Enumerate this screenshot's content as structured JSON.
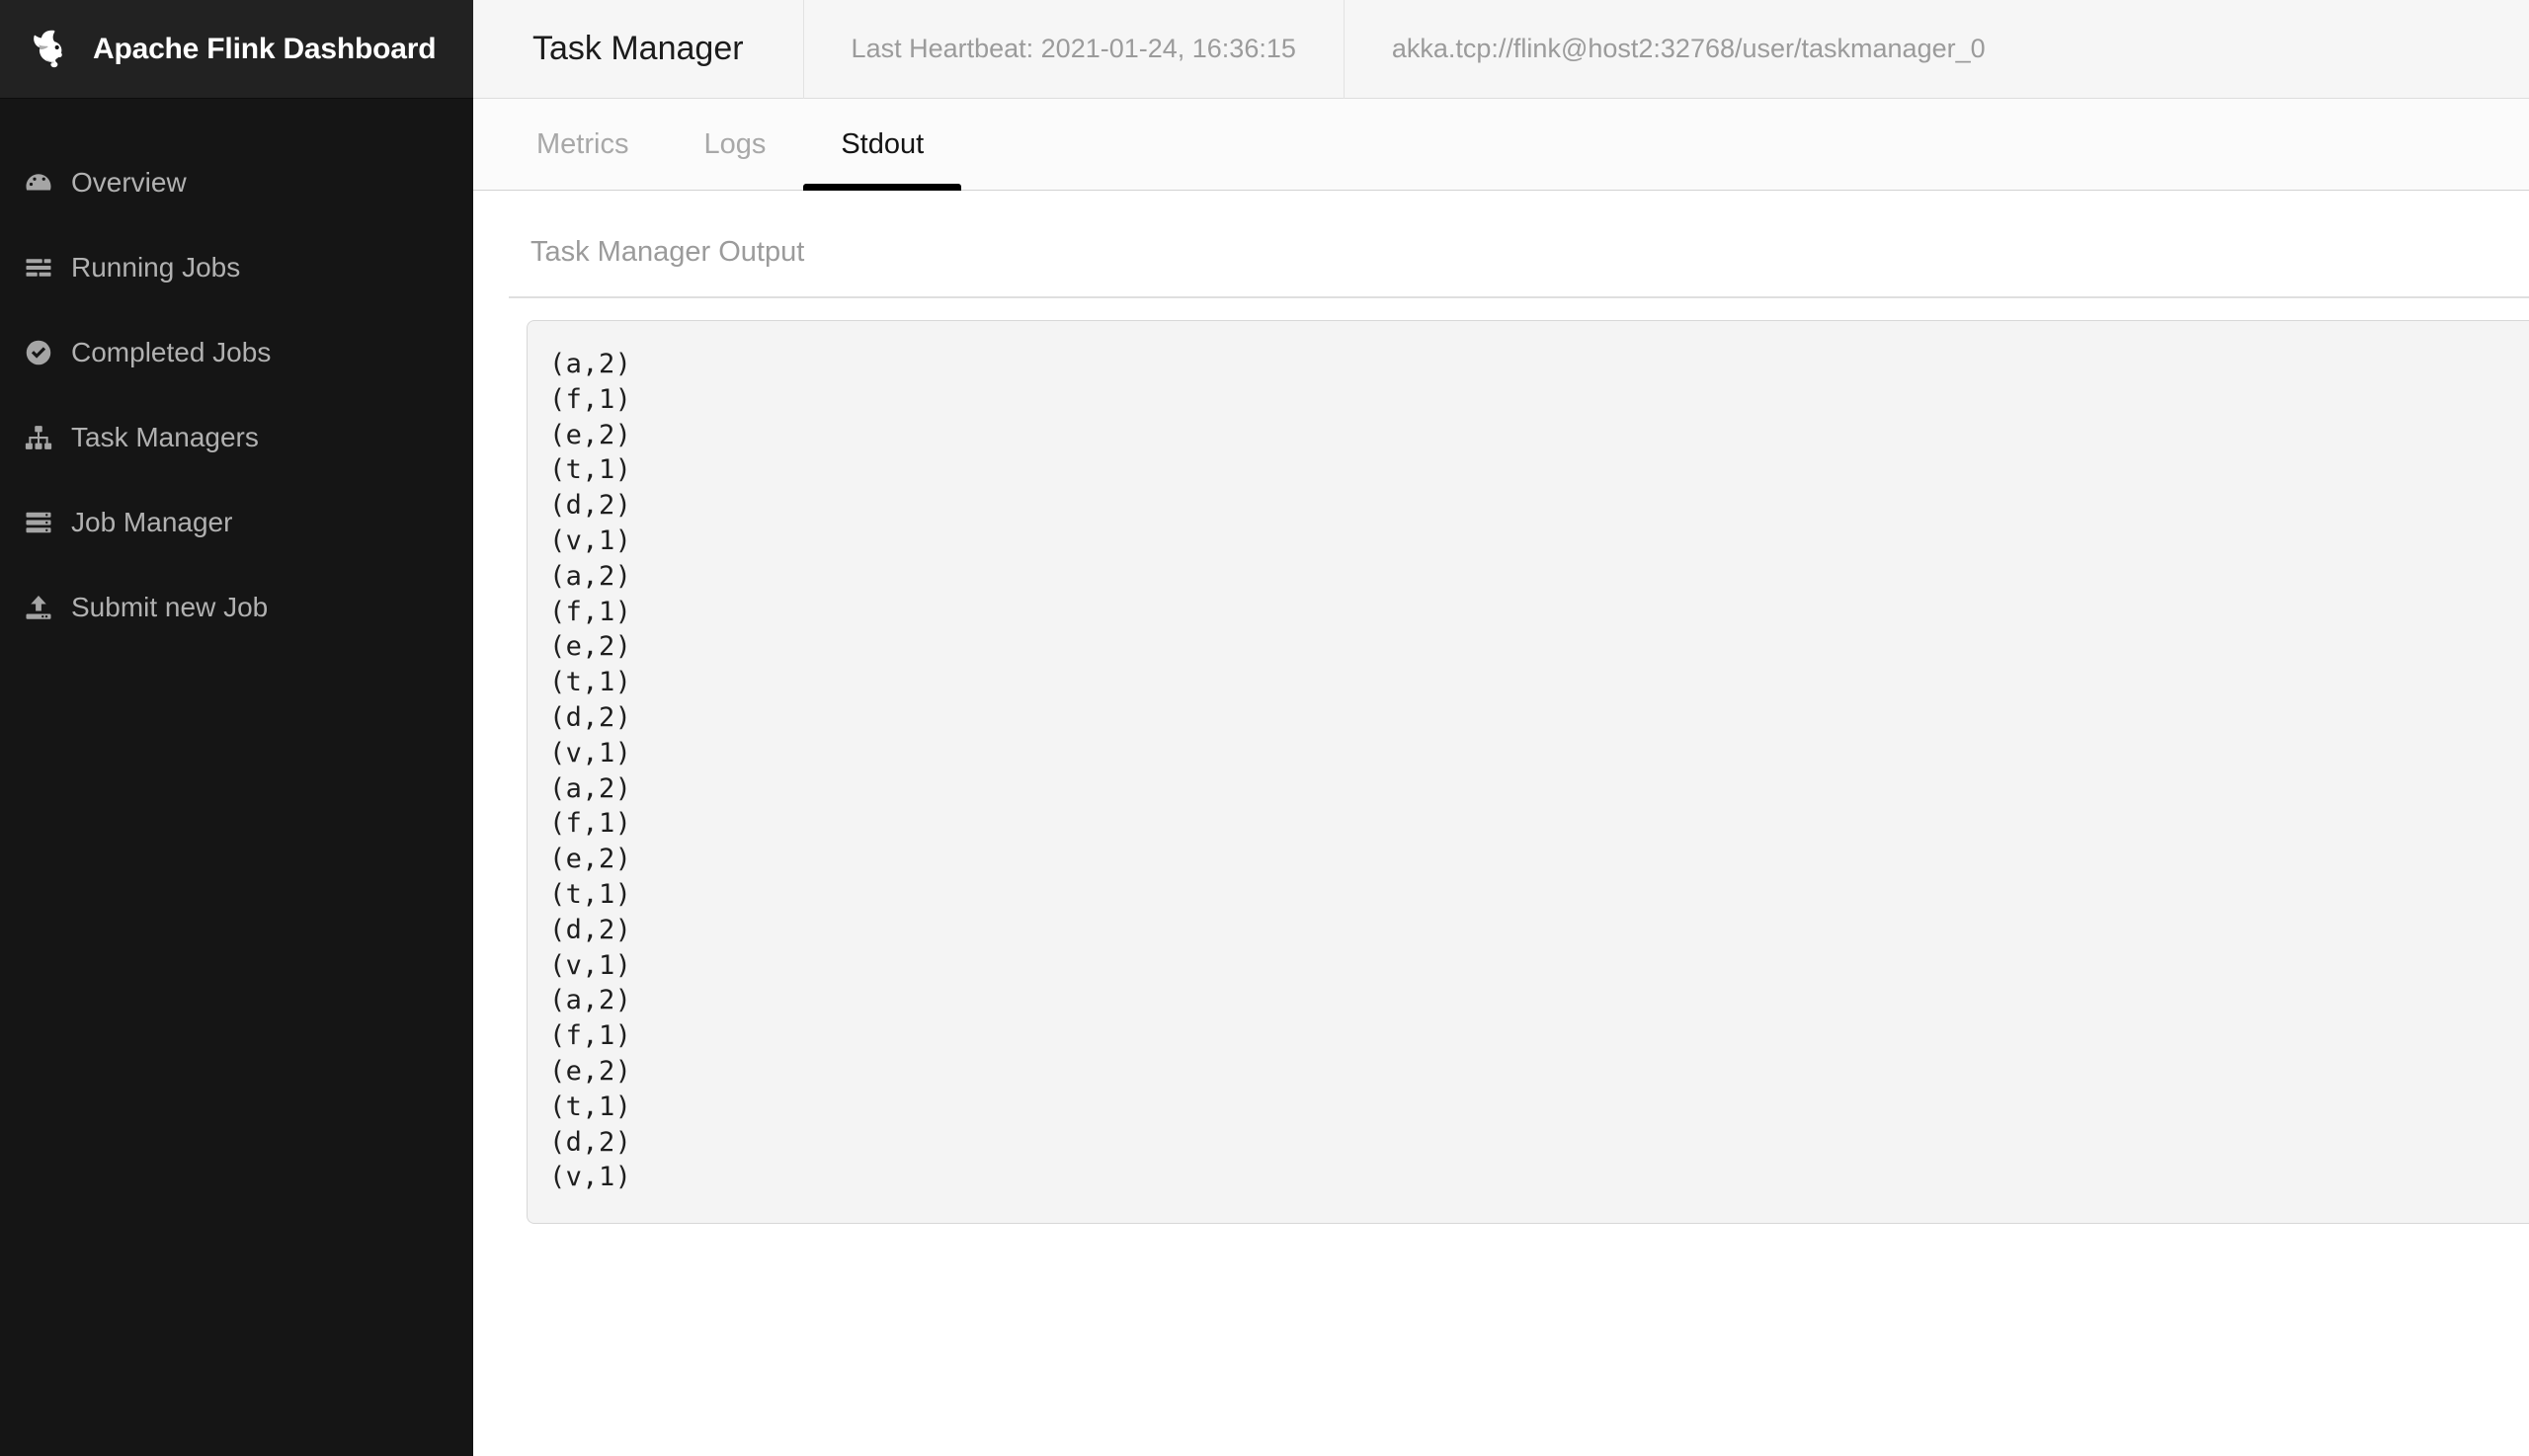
{
  "brand": {
    "title": "Apache Flink Dashboard",
    "logo_icon": "flink-squirrel-icon"
  },
  "sidebar": {
    "items": [
      {
        "label": "Overview",
        "icon": "dashboard-gauge-icon"
      },
      {
        "label": "Running Jobs",
        "icon": "list-bars-icon"
      },
      {
        "label": "Completed Jobs",
        "icon": "check-circle-icon"
      },
      {
        "label": "Task Managers",
        "icon": "sitemap-icon"
      },
      {
        "label": "Job Manager",
        "icon": "server-stack-icon"
      },
      {
        "label": "Submit new Job",
        "icon": "upload-icon"
      }
    ]
  },
  "topbar": {
    "title": "Task Manager",
    "heartbeat": "Last Heartbeat: 2021-01-24, 16:36:15",
    "address": "akka.tcp://flink@host2:32768/user/taskmanager_0"
  },
  "tabs": [
    {
      "label": "Metrics",
      "active": false
    },
    {
      "label": "Logs",
      "active": false
    },
    {
      "label": "Stdout",
      "active": true
    }
  ],
  "main": {
    "output_label": "Task Manager Output",
    "output_lines": [
      "(a,2)",
      "(f,1)",
      "(e,2)",
      "(t,1)",
      "(d,2)",
      "(v,1)",
      "(a,2)",
      "(f,1)",
      "(e,2)",
      "(t,1)",
      "(d,2)",
      "(v,1)",
      "(a,2)",
      "(f,1)",
      "(e,2)",
      "(t,1)",
      "(d,2)",
      "(v,1)",
      "(a,2)",
      "(f,1)",
      "(e,2)",
      "(t,1)",
      "(d,2)",
      "(v,1)"
    ]
  },
  "colors": {
    "sidebar_bg": "#151515",
    "brand_bg": "#222222",
    "topbar_bg": "#f6f6f6",
    "tab_active": "#000000",
    "output_bg": "#f4f4f4",
    "muted_text": "#9b9b9b"
  }
}
